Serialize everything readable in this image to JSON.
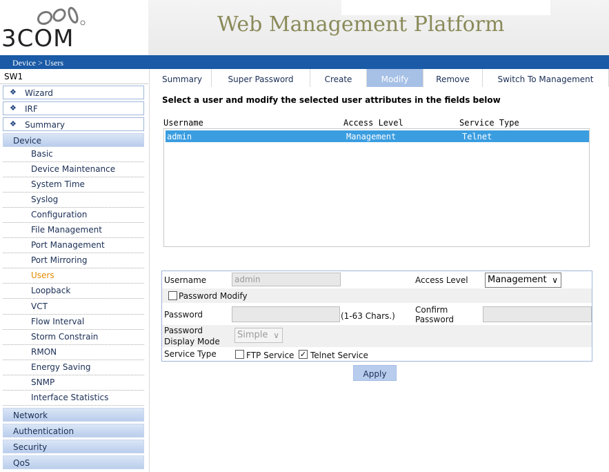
{
  "header": {
    "logo_text": "3COM",
    "platform_title": "Web Management Platform",
    "breadcrumb": "Device > Users"
  },
  "sidebar": {
    "device_name": "SW1",
    "top_items": [
      "Wizard",
      "IRF",
      "Summary"
    ],
    "device_category": "Device",
    "device_items": [
      "Basic",
      "Device Maintenance",
      "System Time",
      "Syslog",
      "Configuration",
      "File Management",
      "Port Management",
      "Port Mirroring",
      "Users",
      "Loopback",
      "VCT",
      "Flow Interval",
      "Storm Constrain",
      "RMON",
      "Energy Saving",
      "SNMP",
      "Interface Statistics"
    ],
    "active_item": "Users",
    "bottom_categories": [
      "Network",
      "Authentication",
      "Security",
      "QoS"
    ]
  },
  "tabs": [
    "Summary",
    "Super Password",
    "Create",
    "Modify",
    "Remove",
    "Switch To Management"
  ],
  "active_tab": "Modify",
  "instruction": "Select a user and modify the selected user attributes in the fields below",
  "user_list": {
    "columns": [
      "Username",
      "Access Level",
      "Service Type"
    ],
    "rows": [
      [
        "admin",
        "Management",
        "Telnet"
      ]
    ]
  },
  "form": {
    "username_label": "Username",
    "username_value": "admin",
    "access_level_label": "Access Level",
    "access_level_value": "Management",
    "password_modify_label": "Password Modify",
    "password_label": "Password",
    "password_hint": "(1-63 Chars.)",
    "confirm_password_label_1": "Confirm",
    "confirm_password_label_2": "Password",
    "display_mode_label_1": "Password",
    "display_mode_label_2": "Display Mode",
    "display_mode_value": "Simple",
    "service_type_label": "Service Type",
    "ftp_service_label": "FTP Service",
    "telnet_service_label": "Telnet Service",
    "ftp_checked": false,
    "telnet_checked": true,
    "password_modify_checked": false
  },
  "apply_label": "Apply",
  "colors": {
    "blue_bar": "#1a5aa6",
    "active_tab": "#a6c0e6",
    "selected_row": "#3a9de0",
    "active_nav": "#e58a00"
  }
}
